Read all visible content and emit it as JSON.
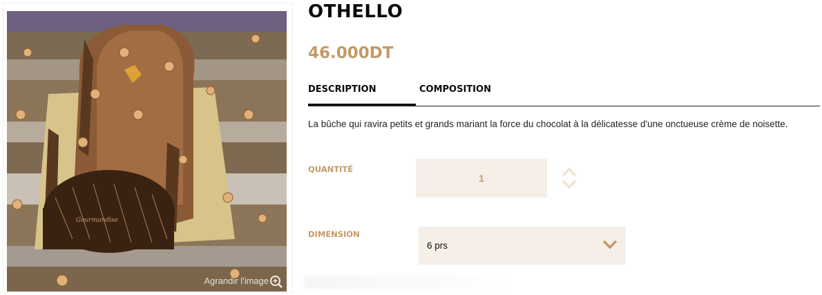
{
  "product": {
    "title": "OTHELLO",
    "price": "46.000DT",
    "image_alt": "Bûche Othello au chocolat et noisettes",
    "image_zoom_label": "Agrandir l'image",
    "image_plaque_text": "Gourmandise"
  },
  "tabs": [
    {
      "label": "DESCRIPTION",
      "active": true
    },
    {
      "label": "COMPOSITION",
      "active": false
    }
  ],
  "description": "La bûche qui ravira petits et grands mariant la force du chocolat à la délicatesse d'une onctueuse crème de noisette.",
  "quantity": {
    "label": "QUANTITÉ",
    "value": "1"
  },
  "dimension": {
    "label": "DIMENSION",
    "selected": "6 prs"
  },
  "colors": {
    "accent": "#c29b66",
    "field_bg": "#f6efe7",
    "text": "#0a0a0a"
  },
  "icons": [
    "zoom-in-icon",
    "chevron-up-icon",
    "chevron-down-icon"
  ]
}
